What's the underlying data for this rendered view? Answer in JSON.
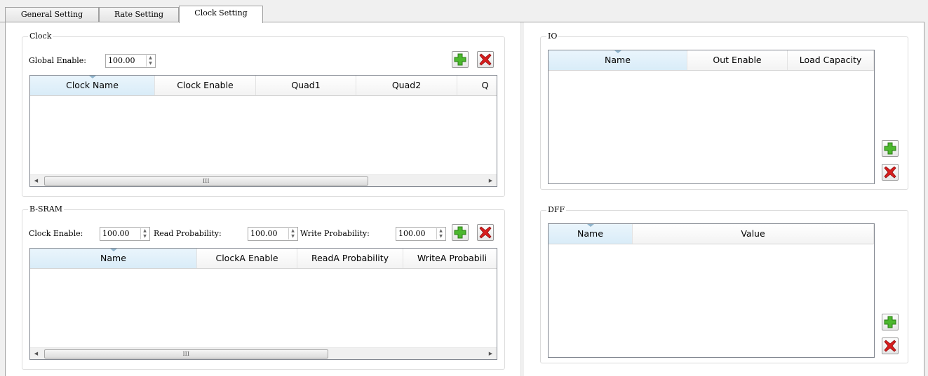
{
  "tabs": [
    {
      "label": "General Setting"
    },
    {
      "label": "Rate Setting"
    },
    {
      "label": "Clock Setting"
    }
  ],
  "clock": {
    "title": "Clock",
    "global_enable_label": "Global Enable:",
    "global_enable_value": "100.00",
    "columns": [
      "Clock Name",
      "Clock Enable",
      "Quad1",
      "Quad2",
      "Q"
    ],
    "rows": [],
    "scroll_grip": "III"
  },
  "bsram": {
    "title": "B-SRAM",
    "clock_enable_label": "Clock Enable:",
    "clock_enable_value": "100.00",
    "read_prob_label": "Read Probability:",
    "read_prob_value": "100.00",
    "write_prob_label": "Write Probability:",
    "write_prob_value": "100.00",
    "columns": [
      "Name",
      "ClockA Enable",
      "ReadA Probability",
      "WriteA Probabili"
    ],
    "rows": [],
    "scroll_grip": "III"
  },
  "io": {
    "title": "IO",
    "columns": [
      "Name",
      "Out Enable",
      "Load Capacity"
    ],
    "rows": []
  },
  "dff": {
    "title": "DFF",
    "columns": [
      "Name",
      "Value"
    ],
    "rows": []
  },
  "icons": {
    "add": "add-icon",
    "delete": "delete-icon",
    "spin_up": "▲",
    "spin_down": "▼",
    "scroll_left": "◀",
    "scroll_right": "▶"
  },
  "colors": {
    "add_green": "#4cb82e",
    "delete_red": "#d81e1e",
    "header_sorted": "#d9ecf8"
  }
}
